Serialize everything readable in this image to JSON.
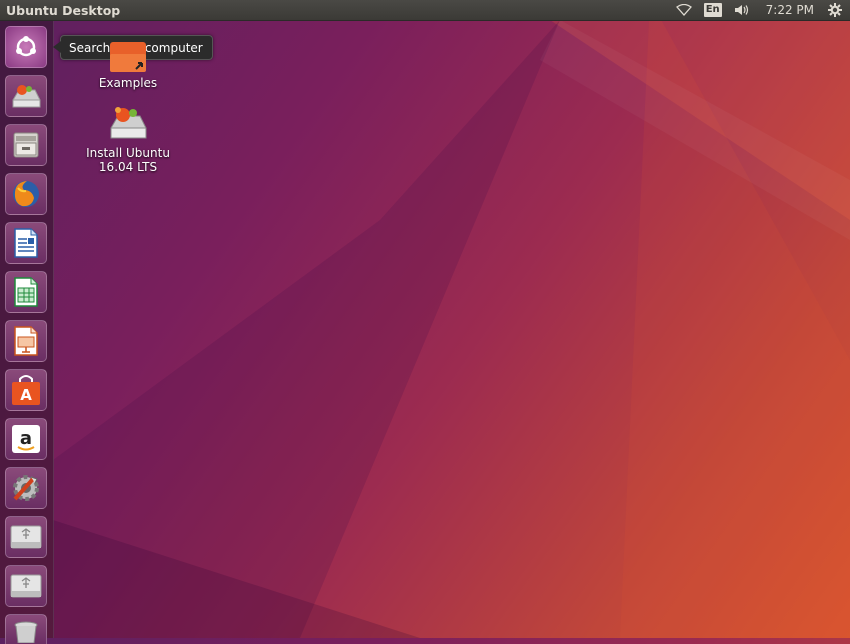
{
  "topbar": {
    "title": "Ubuntu Desktop",
    "keyboard_layout": "En",
    "clock": "7:22 PM",
    "icons": [
      "wifi-icon",
      "keyboard-layout-indicator",
      "volume-icon",
      "settings-gear-icon"
    ]
  },
  "launcher": {
    "tooltip": "Search your computer",
    "items": [
      {
        "name": "dash-home",
        "icon": "ubuntu-logo-icon"
      },
      {
        "name": "install-ubuntu",
        "icon": "installer-icon"
      },
      {
        "name": "files",
        "icon": "file-cabinet-icon"
      },
      {
        "name": "firefox",
        "icon": "firefox-icon"
      },
      {
        "name": "libreoffice-writer",
        "icon": "writer-icon"
      },
      {
        "name": "libreoffice-calc",
        "icon": "calc-icon"
      },
      {
        "name": "libreoffice-impress",
        "icon": "impress-icon"
      },
      {
        "name": "ubuntu-software",
        "icon": "software-bag-icon"
      },
      {
        "name": "amazon",
        "icon": "amazon-icon"
      },
      {
        "name": "system-settings",
        "icon": "settings-tools-icon"
      },
      {
        "name": "usb-drive-1",
        "icon": "usb-drive-icon"
      },
      {
        "name": "usb-drive-2",
        "icon": "usb-drive-icon"
      },
      {
        "name": "trash",
        "icon": "trash-icon"
      }
    ]
  },
  "desktop": {
    "examples_label": "Examples",
    "install_label_line1": "Install Ubuntu",
    "install_label_line2": "16.04 LTS"
  },
  "colors": {
    "wallpaper_start": "#5b2060",
    "wallpaper_end": "#d8552f",
    "panel": "#3b3a36",
    "accent_orange": "#e95420"
  }
}
